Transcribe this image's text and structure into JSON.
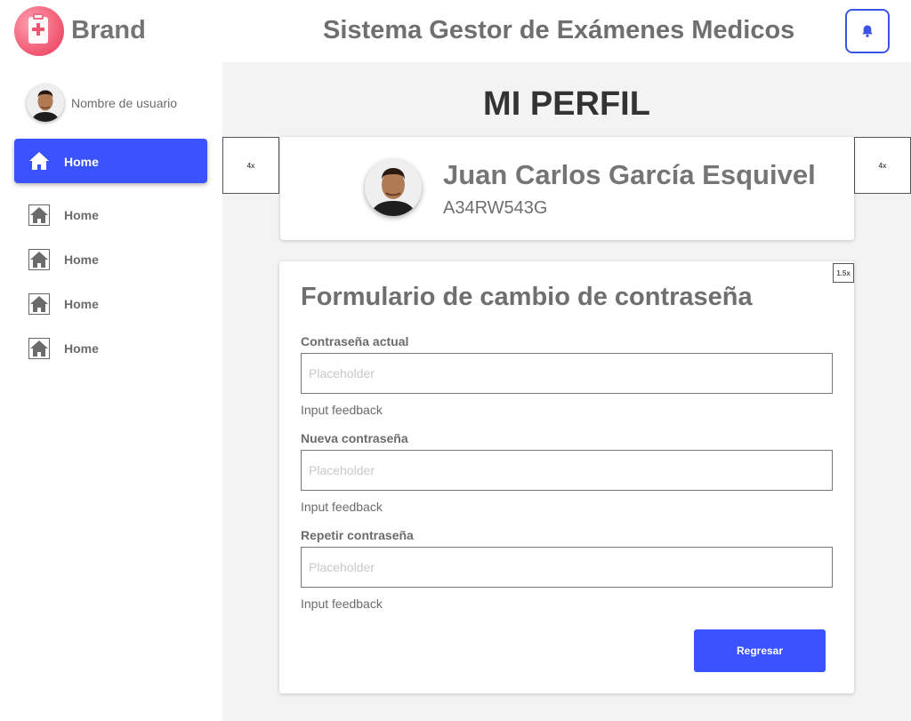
{
  "header": {
    "brand": "Brand",
    "title": "Sistema Gestor de Exámenes Medicos",
    "logo_icon": "medical-clipboard-icon",
    "notification_icon": "bell-icon"
  },
  "sidebar": {
    "username": "Nombre de usuario",
    "items": [
      {
        "label": "Home",
        "icon": "home-icon",
        "active": true
      },
      {
        "label": "Home",
        "icon": "home-icon",
        "active": false
      },
      {
        "label": "Home",
        "icon": "home-icon",
        "active": false
      },
      {
        "label": "Home",
        "icon": "home-icon",
        "active": false
      },
      {
        "label": "Home",
        "icon": "home-icon",
        "active": false
      }
    ]
  },
  "main": {
    "page_title": "MI PERFIL",
    "placeholder_left": "4x",
    "placeholder_right": "4x"
  },
  "profile": {
    "name": "Juan Carlos García Esquivel",
    "id": "A34RW543G"
  },
  "form": {
    "title": "Formulario de cambio de contraseña",
    "zoom_badge": "1.5x",
    "fields": [
      {
        "label": "Contraseña actual",
        "placeholder": "Placeholder",
        "feedback": "Input feedback"
      },
      {
        "label": "Nueva contraseña",
        "placeholder": "Placeholder",
        "feedback": "Input feedback"
      },
      {
        "label": "Repetir contraseña",
        "placeholder": "Placeholder",
        "feedback": "Input feedback"
      }
    ],
    "submit_label": "Regresar"
  },
  "colors": {
    "accent": "#3b53ff",
    "brand_pink": "#f0546e",
    "main_bg": "#f3f3f3"
  }
}
